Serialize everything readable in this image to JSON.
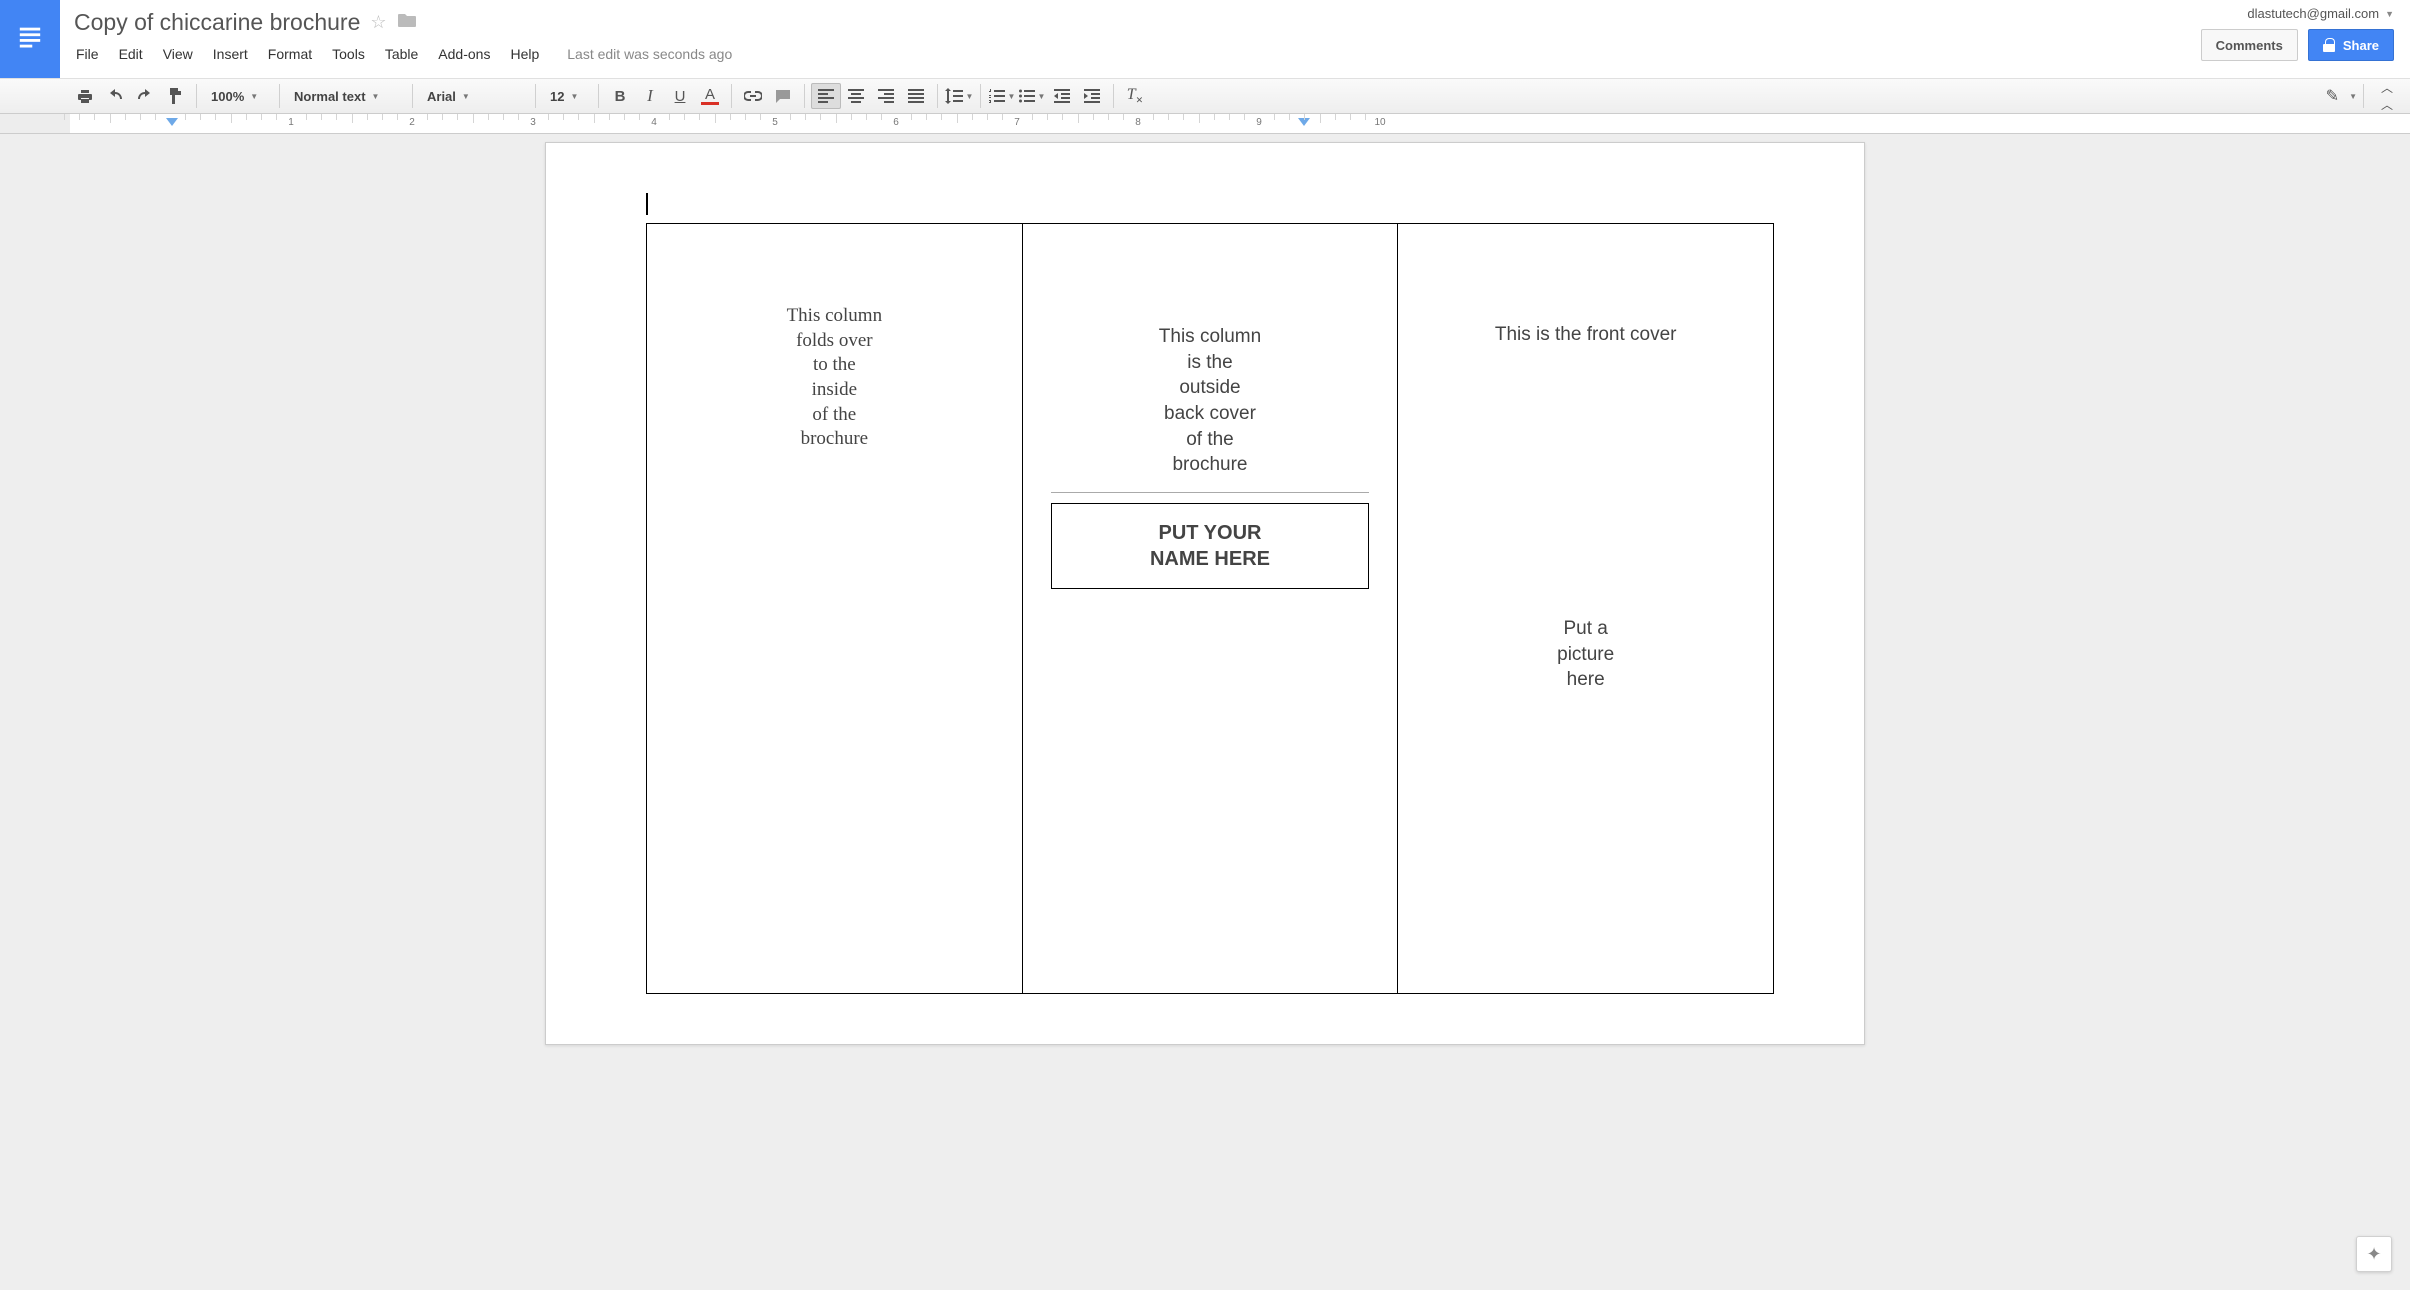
{
  "header": {
    "doc_title": "Copy of chiccarine brochure",
    "account_email": "dlastutech@gmail.com",
    "comments_label": "Comments",
    "share_label": "Share",
    "last_edit": "Last edit was seconds ago"
  },
  "menu": {
    "file": "File",
    "edit": "Edit",
    "view": "View",
    "insert": "Insert",
    "format": "Format",
    "tools": "Tools",
    "table": "Table",
    "addons": "Add-ons",
    "help": "Help"
  },
  "toolbar": {
    "zoom": "100%",
    "style": "Normal text",
    "font": "Arial",
    "size": "12"
  },
  "ruler": {
    "numbers": [
      "1",
      "2",
      "3",
      "4",
      "5",
      "6",
      "7",
      "8",
      "9",
      "10"
    ]
  },
  "document": {
    "col1": {
      "l1": "This column",
      "l2": "folds over",
      "l3": "to the",
      "l4": "inside",
      "l5": "of the",
      "l6": "brochure"
    },
    "col2": {
      "l1": "This column",
      "l2": "is the",
      "l3": "outside",
      "l4": "back cover",
      "l5": "of the",
      "l6": "brochure",
      "name1": "PUT YOUR",
      "name2": "NAME HERE"
    },
    "col3": {
      "title": "This is the front cover",
      "pic1": "Put a",
      "pic2": "picture",
      "pic3": "here"
    }
  }
}
